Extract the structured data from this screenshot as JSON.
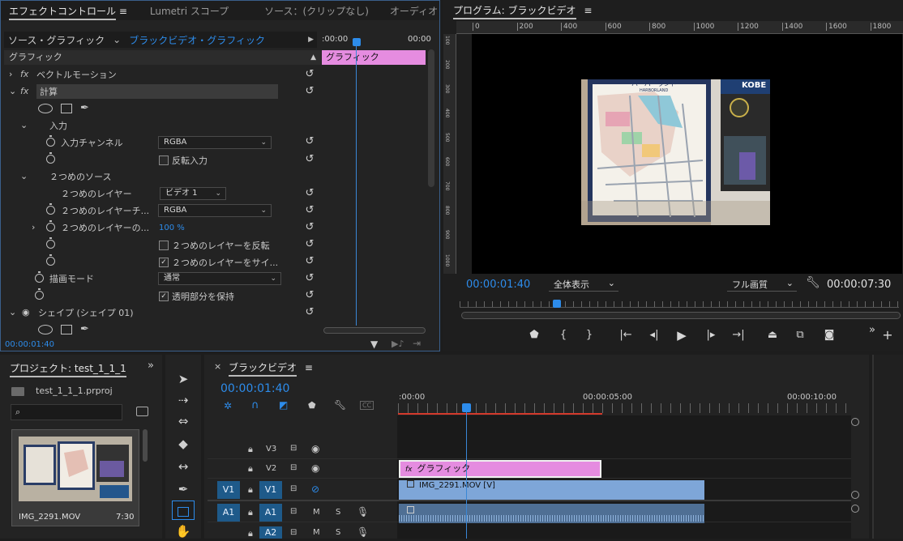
{
  "effect_controls": {
    "tabs": [
      "エフェクトコントロール",
      "Lumetri スコープ",
      "ソース：(クリップなし)",
      "オーディオ"
    ],
    "source_label": "ソース・グラフィック",
    "clip_label": "ブラックビデオ・グラフィック",
    "time_start": ":00:00",
    "time_end": "00:00",
    "clip_bar": "グラフィック",
    "section": "グラフィック",
    "vector_motion": "ベクトルモーション",
    "calc": "計算",
    "input": "入力",
    "input_channel_label": "入力チャンネル",
    "input_channel_value": "RGBA",
    "invert_input": "反転入力",
    "second_source": "２つめのソース",
    "second_layer_label": "２つめのレイヤー",
    "second_layer_value": "ビデオ 1",
    "second_layer_ch_label": "２つめのレイヤーチ...",
    "second_layer_ch_value": "RGBA",
    "second_layer_opacity_label": "２つめのレイヤーの...",
    "second_layer_opacity_value": "100 %",
    "invert_second": "２つめのレイヤーを反転",
    "stretch_second": "２つめのレイヤーをサイ...",
    "blend_mode_label": "描画モード",
    "blend_mode_value": "通常",
    "preserve_alpha": "透明部分を保持",
    "shape": "シェイプ (シェイプ 01)",
    "timecode": "00:00:01:40"
  },
  "program": {
    "title": "プログラム: ブラックビデオ",
    "ruler": [
      "0",
      "200",
      "400",
      "600",
      "800",
      "1000",
      "1200",
      "1400",
      "1600",
      "1800"
    ],
    "vruler": [
      "100",
      "200",
      "300",
      "400",
      "500",
      "600",
      "700",
      "800",
      "900",
      "1000"
    ],
    "map_logo": "ハーバーランド",
    "map_sub": "HARBORLAND",
    "map_side": "KOBE",
    "timecode": "00:00:01:40",
    "fit": "全体表示",
    "quality": "フル画質",
    "duration": "00:00:07:30"
  },
  "project": {
    "title": "プロジェクト: test_1_1_1",
    "file": "test_1_1_1.prproj",
    "clip_name": "IMG_2291.MOV",
    "clip_duration": "7:30"
  },
  "timeline": {
    "title": "ブラックビデオ",
    "timecode": "00:00:01:40",
    "ruler": [
      ":00:00",
      "00:00:05:00",
      "00:00:10:00"
    ],
    "tracks": {
      "v3": "V3",
      "v2": "V2",
      "v1": "V1",
      "a1": "A1",
      "a2": "A2",
      "m": "M",
      "s": "S"
    },
    "graphic_clip": "グラフィック",
    "video_clip": "IMG_2291.MOV [V]",
    "fx": "fx"
  },
  "colors": {
    "accent": "#2d8ceb",
    "graphic_clip": "#e58ce0",
    "video_clip": "#7ea6d8",
    "audio_clip": "#4f6f94"
  }
}
